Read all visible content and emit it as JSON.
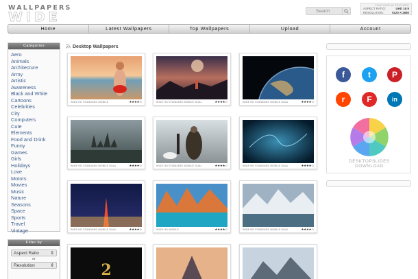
{
  "header": {
    "logo_top": "WALLPAPERS",
    "logo_bottom": "WIDE",
    "search_placeholder": "Search",
    "display": {
      "title": "YOUR DISPLAY FEATURES",
      "aspect_label": "ASPECT RATIO:",
      "aspect_value": "UHD 16:9",
      "resolution_label": "RESOLUTION:",
      "resolution_value": "5120 X 2880"
    }
  },
  "nav": [
    "Home",
    "Latest Wallpapers",
    "Top Wallpapers",
    "Upload",
    "Account"
  ],
  "sidebar": {
    "categories_title": "Categories",
    "categories": [
      "Aero",
      "Animals",
      "Architecture",
      "Army",
      "Artistic",
      "Awareness",
      "Black and White",
      "Cartoons",
      "Celebrities",
      "City",
      "Computers",
      "Cute",
      "Elements",
      "Food and Drink",
      "Funny",
      "Games",
      "Girls",
      "Holidays",
      "Love",
      "Motors",
      "Movies",
      "Music",
      "Nature",
      "Seasons",
      "Space",
      "Sports",
      "Travel",
      "Vintage"
    ],
    "filter_title": "Filter by",
    "aspect_select": "Aspect Ratio",
    "or_text": "or",
    "resolution_select": "Resolution"
  },
  "main": {
    "title": "Desktop Wallpapers",
    "thumbs": [
      {
        "tags": "WIDE HD STANDARD MOBILE",
        "stars": "★★★★☆"
      },
      {
        "tags": "WIDE HD STANDARD MOBILE DUAL",
        "stars": "★★★★☆"
      },
      {
        "tags": "WIDE HD STANDARD MOBILE DUAL",
        "stars": "★★★★☆"
      },
      {
        "tags": "WIDE HD STANDARD MOBILE DUAL",
        "stars": "★★★★☆"
      },
      {
        "tags": "WIDE HD STANDARD MOBILE DUAL",
        "stars": "★★★★☆"
      },
      {
        "tags": "WIDE HD STANDARD MOBILE DUAL",
        "stars": "★★★★☆"
      },
      {
        "tags": "WIDE HD STANDARD MOBILE DUAL",
        "stars": "★★★★☆"
      },
      {
        "tags": "WIDE HD MOBILE",
        "stars": "★★★★☆"
      },
      {
        "tags": "WIDE HD STANDARD MOBILE DUAL",
        "stars": "★★★★☆"
      },
      {
        "tags": "",
        "stars": ""
      },
      {
        "tags": "",
        "stars": ""
      },
      {
        "tags": "",
        "stars": ""
      }
    ]
  },
  "right": {
    "social": [
      {
        "icon": "facebook-icon",
        "glyph": "f",
        "color": "#3b5998"
      },
      {
        "icon": "twitter-icon",
        "glyph": "t",
        "color": "#1da1f2"
      },
      {
        "icon": "pinterest-icon",
        "glyph": "P",
        "color": "#cb2027"
      },
      {
        "icon": "reddit-icon",
        "glyph": "r",
        "color": "#ff4500"
      },
      {
        "icon": "flipboard-icon",
        "glyph": "F",
        "color": "#e12828"
      },
      {
        "icon": "linkedin-icon",
        "glyph": "in",
        "color": "#0077b5"
      }
    ],
    "desktopslides_line1": "DESKTOPSLIDES",
    "desktopslides_line2": "DOWNLOAD"
  }
}
